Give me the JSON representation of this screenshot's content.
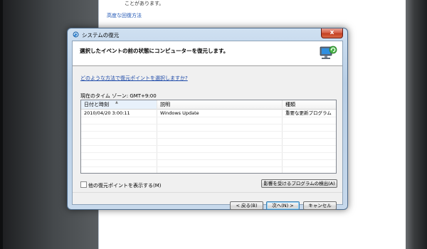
{
  "background": {
    "text_top": "ことがあります。",
    "link": "高度な回復方法"
  },
  "dialog": {
    "title": "システムの復元",
    "close_label": "x",
    "header_title": "選択したイベントの前の状態にコンピューターを復元します。",
    "help_link": "どのような方法で復元ポイントを選択しますか?",
    "timezone": "現在のタイム ゾーン: GMT+9:00",
    "table": {
      "columns": [
        "日付と時刻",
        "説明",
        "種類"
      ],
      "rows": [
        {
          "date": "2010/04/20 3:00:11",
          "description": "Windows Update",
          "type": "重要な更新プログラム"
        }
      ]
    },
    "show_more_label": "他の復元ポイントを表示する(M)",
    "show_more_checked": false,
    "scan_button": "影響を受けるプログラムの検出(A)",
    "back_button": "< 戻る(B)",
    "next_button": "次へ(N) >",
    "cancel_button": "キャンセル"
  }
}
